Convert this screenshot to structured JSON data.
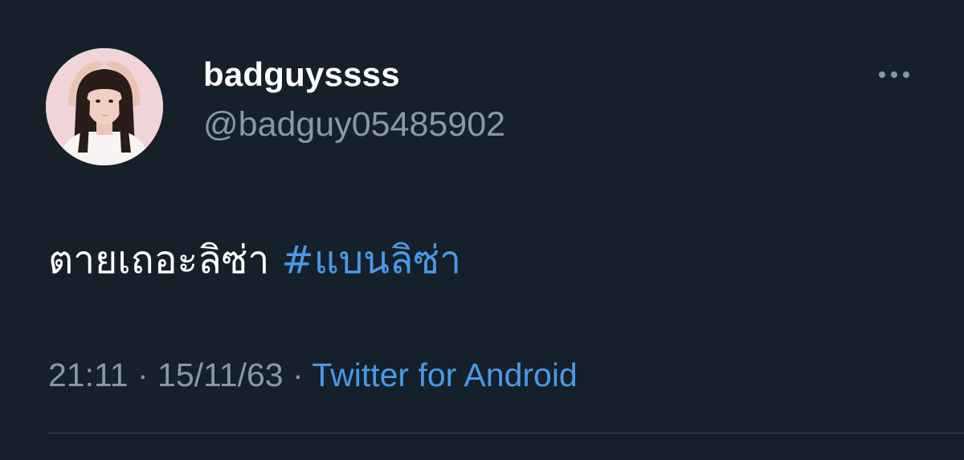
{
  "tweet": {
    "author": {
      "display_name": "badguyssss",
      "handle": "@badguy05485902"
    },
    "text": "ตายเถอะลิซ่า",
    "hashtag": "#แบนลิซ่า",
    "time": "21:11",
    "separator": "·",
    "date": "15/11/63",
    "source": "Twitter for Android"
  },
  "icons": {
    "more": "more-horizontal-icon",
    "avatar": "profile-avatar"
  },
  "colors": {
    "background": "#15202b",
    "text_primary": "#ffffff",
    "text_secondary": "#8899a6",
    "accent": "#4a99e9",
    "divider": "#38444d"
  }
}
